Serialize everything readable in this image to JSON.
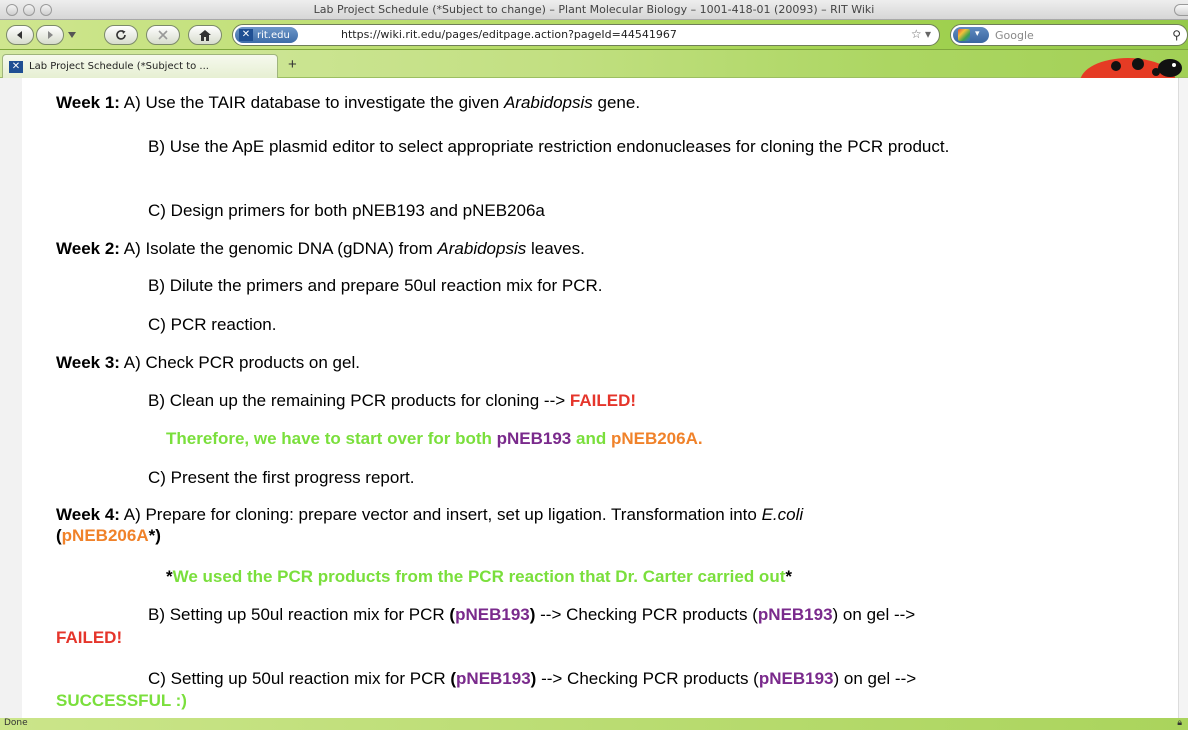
{
  "window": {
    "title": "Lab Project Schedule (*Subject to change) – Plant Molecular Biology – 1001-418-01 (20093) – RIT Wiki"
  },
  "toolbar": {
    "back_icon": "back-arrow-icon",
    "forward_icon": "forward-arrow-icon",
    "reload_icon": "reload-icon",
    "stop_icon": "stop-icon",
    "home_icon": "home-icon",
    "site_label": "rit.edu",
    "url": "https://wiki.rit.edu/pages/editpage.action?pageId=44541967",
    "search_placeholder": "Google"
  },
  "tabs": [
    {
      "label": "Lab Project Schedule (*Subject to ..."
    }
  ],
  "tab_add_label": "+",
  "colors": {
    "green": "#7adf3c",
    "purple": "#7a2a8c",
    "orange": "#f0822a",
    "red": "#e5352b"
  },
  "doc": {
    "w1": {
      "label": "Week 1:",
      "a_pre": " A) Use the TAIR database to investigate the given ",
      "a_italic": "Arabidopsis",
      "a_post": " gene.",
      "b": "B) Use the ApE plasmid editor to select appropriate restriction endonucleases for cloning the PCR product.",
      "c": "C) Design primers for both pNEB193 and pNEB206a"
    },
    "w2": {
      "label": "Week 2:",
      "a_pre": " A) Isolate the genomic DNA (gDNA) from ",
      "a_italic": "Arabidopsis",
      "a_post": " leaves.",
      "b": "B) Dilute the primers and prepare 50ul reaction mix for PCR.",
      "c": "C) PCR reaction."
    },
    "w3": {
      "label": "Week 3:",
      "a": " A) Check PCR products on gel.",
      "b_pre": "B) Clean up the remaining PCR products for cloning --> ",
      "b_failed": "FAILED!",
      "note_pre": "Therefore, we have to start over for both ",
      "note_p193": "pNEB193",
      "note_and": " and ",
      "note_p206": "pNEB206A.",
      "c": "C) Present the first progress report."
    },
    "w4": {
      "label": "Week 4:",
      "a_pre": " A) Prepare for cloning: prepare vector and insert, set up ligation. Transformation into ",
      "a_italic": "E.coli",
      "a_open": " (",
      "a_p206": "pNEB206A",
      "a_close": "*)",
      "note_star1": "*",
      "note_text": "We used the PCR products from the PCR reaction that Dr. Carter carried out",
      "note_star2": "*",
      "b_pre": "B) Setting up 50ul reaction mix for PCR ",
      "b_paren_open": "(",
      "b_p193": "pNEB193",
      "b_paren_close": ")",
      "b_mid": " --> Checking PCR products (",
      "b_p193b": "pNEB193",
      "b_post": ") on gel -->",
      "b_result": "FAILED!",
      "c_pre": "C) Setting up 50ul reaction mix for PCR ",
      "c_paren_open": "(",
      "c_p193": "pNEB193",
      "c_paren_close": ")",
      "c_mid": " --> Checking PCR products (",
      "c_p193b": "pNEB193",
      "c_post": ") on gel -->",
      "c_result": "SUCCESSFUL :)"
    }
  },
  "status": {
    "text": "Done",
    "lock_icon": "lock-icon"
  }
}
